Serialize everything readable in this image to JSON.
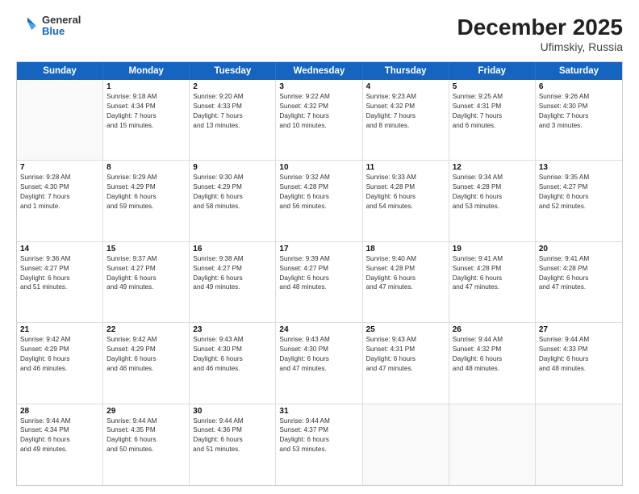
{
  "header": {
    "logo": {
      "general": "General",
      "blue": "Blue"
    },
    "title": "December 2025",
    "location": "Ufimskiy, Russia"
  },
  "calendar": {
    "days": [
      "Sunday",
      "Monday",
      "Tuesday",
      "Wednesday",
      "Thursday",
      "Friday",
      "Saturday"
    ],
    "rows": [
      [
        {
          "day": "",
          "info": ""
        },
        {
          "day": "1",
          "info": "Sunrise: 9:18 AM\nSunset: 4:34 PM\nDaylight: 7 hours\nand 15 minutes."
        },
        {
          "day": "2",
          "info": "Sunrise: 9:20 AM\nSunset: 4:33 PM\nDaylight: 7 hours\nand 13 minutes."
        },
        {
          "day": "3",
          "info": "Sunrise: 9:22 AM\nSunset: 4:32 PM\nDaylight: 7 hours\nand 10 minutes."
        },
        {
          "day": "4",
          "info": "Sunrise: 9:23 AM\nSunset: 4:32 PM\nDaylight: 7 hours\nand 8 minutes."
        },
        {
          "day": "5",
          "info": "Sunrise: 9:25 AM\nSunset: 4:31 PM\nDaylight: 7 hours\nand 6 minutes."
        },
        {
          "day": "6",
          "info": "Sunrise: 9:26 AM\nSunset: 4:30 PM\nDaylight: 7 hours\nand 3 minutes."
        }
      ],
      [
        {
          "day": "7",
          "info": "Sunrise: 9:28 AM\nSunset: 4:30 PM\nDaylight: 7 hours\nand 1 minute."
        },
        {
          "day": "8",
          "info": "Sunrise: 9:29 AM\nSunset: 4:29 PM\nDaylight: 6 hours\nand 59 minutes."
        },
        {
          "day": "9",
          "info": "Sunrise: 9:30 AM\nSunset: 4:29 PM\nDaylight: 6 hours\nand 58 minutes."
        },
        {
          "day": "10",
          "info": "Sunrise: 9:32 AM\nSunset: 4:28 PM\nDaylight: 6 hours\nand 56 minutes."
        },
        {
          "day": "11",
          "info": "Sunrise: 9:33 AM\nSunset: 4:28 PM\nDaylight: 6 hours\nand 54 minutes."
        },
        {
          "day": "12",
          "info": "Sunrise: 9:34 AM\nSunset: 4:28 PM\nDaylight: 6 hours\nand 53 minutes."
        },
        {
          "day": "13",
          "info": "Sunrise: 9:35 AM\nSunset: 4:27 PM\nDaylight: 6 hours\nand 52 minutes."
        }
      ],
      [
        {
          "day": "14",
          "info": "Sunrise: 9:36 AM\nSunset: 4:27 PM\nDaylight: 6 hours\nand 51 minutes."
        },
        {
          "day": "15",
          "info": "Sunrise: 9:37 AM\nSunset: 4:27 PM\nDaylight: 6 hours\nand 49 minutes."
        },
        {
          "day": "16",
          "info": "Sunrise: 9:38 AM\nSunset: 4:27 PM\nDaylight: 6 hours\nand 49 minutes."
        },
        {
          "day": "17",
          "info": "Sunrise: 9:39 AM\nSunset: 4:27 PM\nDaylight: 6 hours\nand 48 minutes."
        },
        {
          "day": "18",
          "info": "Sunrise: 9:40 AM\nSunset: 4:28 PM\nDaylight: 6 hours\nand 47 minutes."
        },
        {
          "day": "19",
          "info": "Sunrise: 9:41 AM\nSunset: 4:28 PM\nDaylight: 6 hours\nand 47 minutes."
        },
        {
          "day": "20",
          "info": "Sunrise: 9:41 AM\nSunset: 4:28 PM\nDaylight: 6 hours\nand 47 minutes."
        }
      ],
      [
        {
          "day": "21",
          "info": "Sunrise: 9:42 AM\nSunset: 4:29 PM\nDaylight: 6 hours\nand 46 minutes."
        },
        {
          "day": "22",
          "info": "Sunrise: 9:42 AM\nSunset: 4:29 PM\nDaylight: 6 hours\nand 46 minutes."
        },
        {
          "day": "23",
          "info": "Sunrise: 9:43 AM\nSunset: 4:30 PM\nDaylight: 6 hours\nand 46 minutes."
        },
        {
          "day": "24",
          "info": "Sunrise: 9:43 AM\nSunset: 4:30 PM\nDaylight: 6 hours\nand 47 minutes."
        },
        {
          "day": "25",
          "info": "Sunrise: 9:43 AM\nSunset: 4:31 PM\nDaylight: 6 hours\nand 47 minutes."
        },
        {
          "day": "26",
          "info": "Sunrise: 9:44 AM\nSunset: 4:32 PM\nDaylight: 6 hours\nand 48 minutes."
        },
        {
          "day": "27",
          "info": "Sunrise: 9:44 AM\nSunset: 4:33 PM\nDaylight: 6 hours\nand 48 minutes."
        }
      ],
      [
        {
          "day": "28",
          "info": "Sunrise: 9:44 AM\nSunset: 4:34 PM\nDaylight: 6 hours\nand 49 minutes."
        },
        {
          "day": "29",
          "info": "Sunrise: 9:44 AM\nSunset: 4:35 PM\nDaylight: 6 hours\nand 50 minutes."
        },
        {
          "day": "30",
          "info": "Sunrise: 9:44 AM\nSunset: 4:36 PM\nDaylight: 6 hours\nand 51 minutes."
        },
        {
          "day": "31",
          "info": "Sunrise: 9:44 AM\nSunset: 4:37 PM\nDaylight: 6 hours\nand 53 minutes."
        },
        {
          "day": "",
          "info": ""
        },
        {
          "day": "",
          "info": ""
        },
        {
          "day": "",
          "info": ""
        }
      ]
    ]
  }
}
